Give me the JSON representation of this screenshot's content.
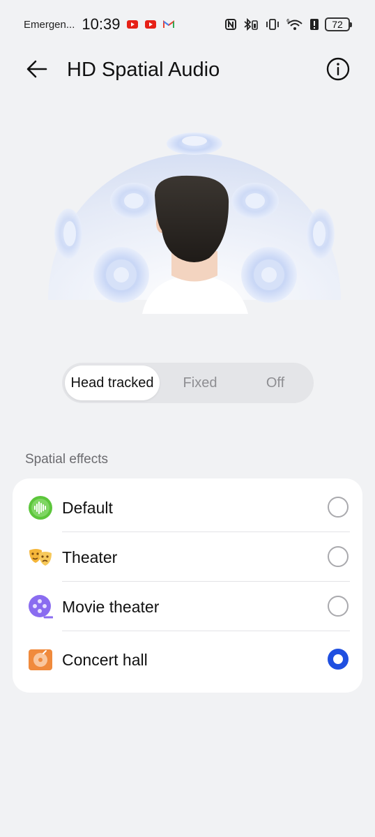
{
  "status_bar": {
    "carrier": "Emergen...",
    "time": "10:39",
    "battery": "72",
    "notification_icons": [
      "youtube-icon",
      "youtube-icon",
      "gmail-icon"
    ],
    "system_icons": [
      "nfc-icon",
      "bluetooth-battery-icon",
      "vibrate-icon",
      "wifi-6-icon",
      "alert-icon",
      "battery-icon"
    ]
  },
  "header": {
    "title": "HD Spatial Audio"
  },
  "mode_selector": {
    "options": [
      "Head tracked",
      "Fixed",
      "Off"
    ],
    "selected": "Head tracked"
  },
  "spatial_effects": {
    "label": "Spatial effects",
    "items": [
      {
        "label": "Default",
        "icon": "sound-wave-icon",
        "selected": false,
        "color": "#5cc63b"
      },
      {
        "label": "Theater",
        "icon": "theater-masks-icon",
        "selected": false,
        "color": "#f5b63a"
      },
      {
        "label": "Movie theater",
        "icon": "film-reel-icon",
        "selected": false,
        "color": "#8a6cf0"
      },
      {
        "label": "Concert hall",
        "icon": "music-disc-icon",
        "selected": true,
        "color": "#f08a3c"
      }
    ]
  },
  "colors": {
    "accent": "#1f4fe0",
    "background": "#f1f2f4"
  }
}
